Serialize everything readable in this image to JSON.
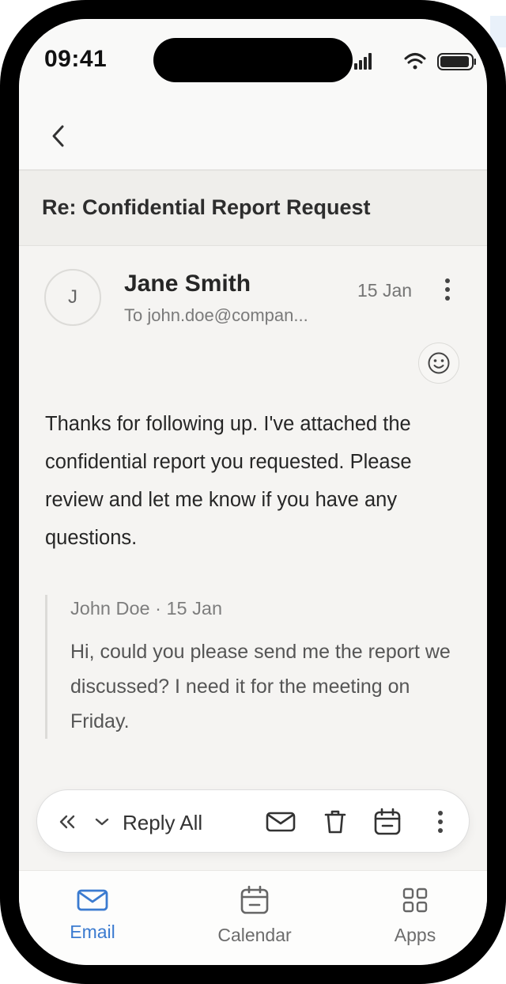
{
  "status": {
    "time": "09:41"
  },
  "email": {
    "subject": "Re: Confidential Report Request",
    "sender_initial": "J",
    "sender_name": "Jane Smith",
    "recipient": "To john.doe@compan...",
    "date": "15 Jan",
    "body": "Thanks for following up. I've attached the confidential report you requested. Please review and let me know if you have any questions.",
    "quote": {
      "meta": "John Doe · 15 Jan",
      "text": "Hi, could you please send me the report we discussed? I need it for the meeting on Friday."
    }
  },
  "actions": {
    "reply_label": "Reply All",
    "icons": [
      "reply-all-icon",
      "chevron-down-icon",
      "envelope-icon",
      "trash-icon",
      "calendar-icon",
      "more-vertical-icon"
    ]
  },
  "tabs": [
    {
      "label": "Email",
      "icon": "mail-icon",
      "active": true
    },
    {
      "label": "Calendar",
      "icon": "calendar-icon",
      "active": false
    },
    {
      "label": "Apps",
      "icon": "apps-grid-icon",
      "active": false
    }
  ],
  "colors": {
    "accent": "#3b7bd0",
    "background": "#f5f4f2",
    "frame": "#000000"
  }
}
